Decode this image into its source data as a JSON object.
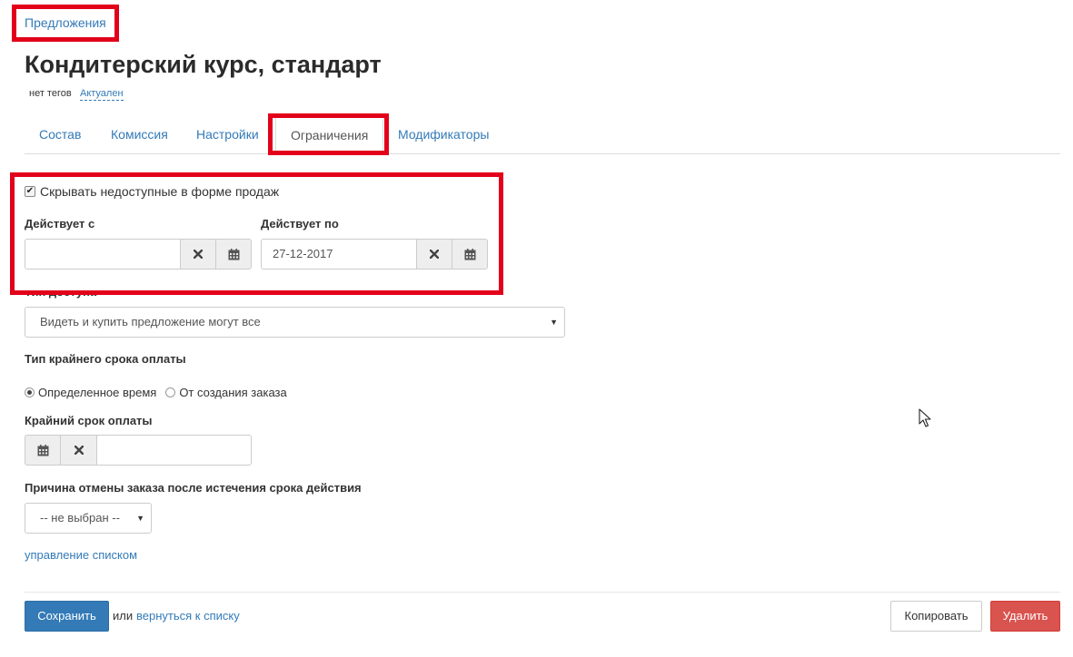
{
  "breadcrumb": {
    "label": "Предложения"
  },
  "page": {
    "title": "Кондитерский курс, стандарт",
    "tags_text": "нет тегов",
    "status_link": "Актуален"
  },
  "tabs": [
    {
      "label": "Состав",
      "active": false
    },
    {
      "label": "Комиссия",
      "active": false
    },
    {
      "label": "Настройки",
      "active": false
    },
    {
      "label": "Ограничения",
      "active": true
    },
    {
      "label": "Модификаторы",
      "active": false
    }
  ],
  "form": {
    "hide_unavailable": {
      "label": "Скрывать недоступные в форме продаж",
      "checked": true
    },
    "valid_from": {
      "label": "Действует с",
      "value": ""
    },
    "valid_to": {
      "label": "Действует по",
      "value": "27-12-2017"
    },
    "access_type": {
      "label": "Тип доступа",
      "selected": "Видеть и купить предложение могут все"
    },
    "deadline_type": {
      "label": "Тип крайнего срока оплаты",
      "options": [
        {
          "label": "Определенное время",
          "selected": true
        },
        {
          "label": "От создания заказа",
          "selected": false
        }
      ]
    },
    "payment_deadline": {
      "label": "Крайний срок оплаты",
      "value": ""
    },
    "cancel_reason": {
      "label": "Причина отмены заказа после истечения срока действия",
      "selected": "-- не выбран --"
    },
    "manage_list_link": "управление списком"
  },
  "footer": {
    "save_label": "Сохранить",
    "or_text": "или",
    "back_link": "вернуться к списку",
    "copy_label": "Копировать",
    "delete_label": "Удалить"
  },
  "icons": {
    "checkmark": "✔",
    "clear": "close-icon",
    "calendar": "calendar-icon",
    "caret": "▼"
  },
  "colors": {
    "link": "#337ab7",
    "primary": "#337ab7",
    "danger": "#d9534f",
    "annotation": "#e2001a"
  }
}
